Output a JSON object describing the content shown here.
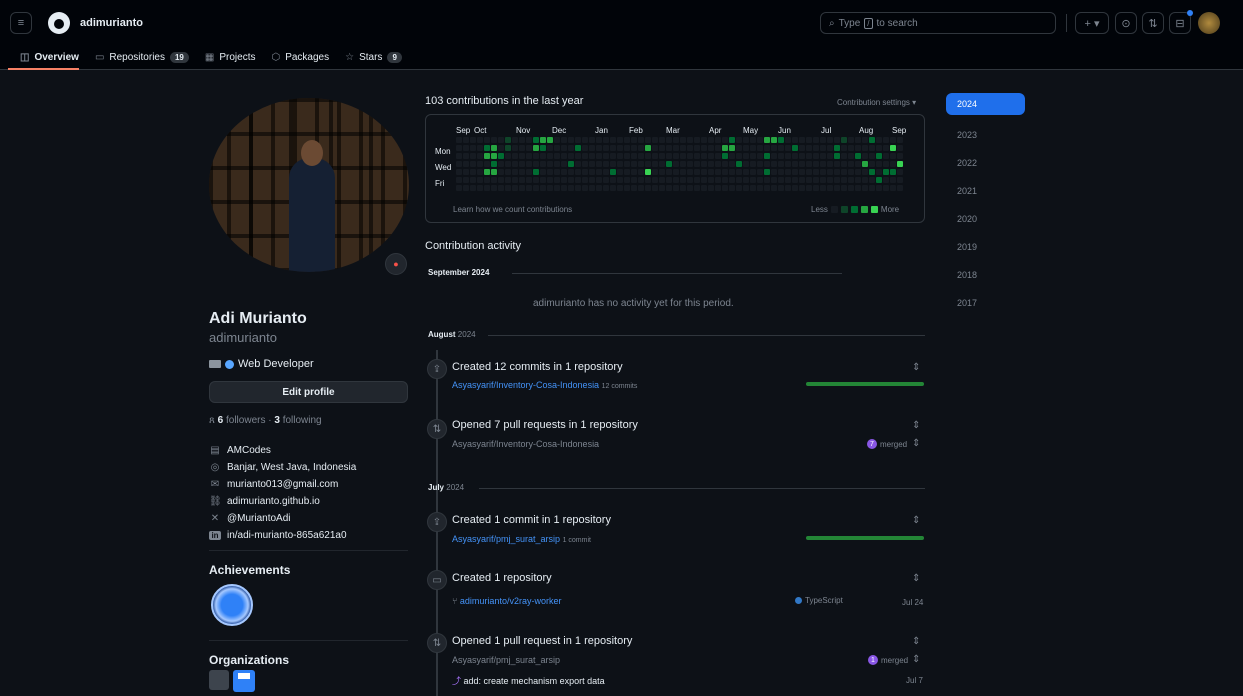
{
  "header": {
    "username": "adimurianto",
    "search": {
      "placeholder_before": "Type",
      "key": "/",
      "placeholder_after": "to search"
    },
    "tabs": [
      {
        "label": "Overview",
        "icon": "book-icon"
      },
      {
        "label": "Repositories",
        "count": "19",
        "icon": "repo-icon"
      },
      {
        "label": "Projects",
        "icon": "table-icon"
      },
      {
        "label": "Packages",
        "icon": "package-icon"
      },
      {
        "label": "Stars",
        "count": "9",
        "icon": "star-icon"
      }
    ]
  },
  "profile": {
    "full_name": "Adi Murianto",
    "login": "adimurianto",
    "bio": "Web Developer",
    "edit_label": "Edit profile",
    "followers": "6",
    "followers_label": "followers",
    "following": "3",
    "following_label": "following",
    "vcard": [
      {
        "icon": "organization-icon",
        "text": "AMCodes"
      },
      {
        "icon": "location-icon",
        "text": "Banjar, West Java, Indonesia"
      },
      {
        "icon": "mail-icon",
        "text": "murianto013@gmail.com"
      },
      {
        "icon": "link-icon",
        "text": "adimurianto.github.io"
      },
      {
        "icon": "x-icon",
        "text": "@MuriantoAdi"
      },
      {
        "icon": "linkedin-icon",
        "text": "in/adi-murianto-865a621a0"
      }
    ],
    "achievements_title": "Achievements",
    "organizations_title": "Organizations"
  },
  "contributions": {
    "title": "103 contributions in the last year",
    "settings": "Contribution settings",
    "months": [
      "Sep",
      "Oct",
      "Nov",
      "Dec",
      "Jan",
      "Feb",
      "Mar",
      "Apr",
      "May",
      "Jun",
      "Jul",
      "Aug",
      "Sep"
    ],
    "days": [
      "Mon",
      "Wed",
      "Fri"
    ],
    "learn": "Learn how we count contributions",
    "less": "Less",
    "more": "More",
    "colors": [
      "#161b22",
      "#0e4429",
      "#006d32",
      "#26a641",
      "#39d353"
    ]
  },
  "activity": {
    "title": "Contribution activity",
    "sep": {
      "month": "September",
      "year": "2024",
      "empty": "adimurianto has no activity yet for this period."
    },
    "aug": {
      "month": "August",
      "year": "2024",
      "commits_title": "Created 12 commits in 1 repository",
      "commits_repo": "Asyasyarif/Inventory-Cosa-Indonesia",
      "commits_count": "12 commits",
      "pr_title": "Opened 7 pull requests in 1 repository",
      "pr_repo": "Asyasyarif/Inventory-Cosa-Indonesia",
      "pr_merged_count": "7",
      "pr_merged_label": "merged"
    },
    "jul": {
      "month": "July",
      "year": "2024",
      "commits_title": "Created 1 commit in 1 repository",
      "commits_repo": "Asyasyarif/pmj_surat_arsip",
      "commits_count": "1 commit",
      "repo_title": "Created 1 repository",
      "repo_name": "adimurianto/v2ray-worker",
      "repo_lang": "TypeScript",
      "repo_date": "Jul 24",
      "pr_title": "Opened 1 pull request in 1 repository",
      "pr_repo": "Asyasyarif/pmj_surat_arsip",
      "pr_merged_count": "1",
      "pr_merged_label": "merged",
      "pr_item": "add: create mechanism export data",
      "pr_date": "Jul 7"
    }
  },
  "years": [
    "2024",
    "2023",
    "2022",
    "2021",
    "2020",
    "2019",
    "2018",
    "2017"
  ]
}
